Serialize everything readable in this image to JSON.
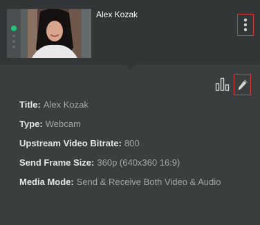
{
  "participant": {
    "name": "Alex Kozak",
    "status_color": "#22c77a"
  },
  "icons": {
    "menu": "more-vertical-icon",
    "stats": "bar-chart-icon",
    "edit": "pencil-icon"
  },
  "details": [
    {
      "label": "Title:",
      "value": "Alex Kozak"
    },
    {
      "label": "Type:",
      "value": "Webcam"
    },
    {
      "label": "Upstream Video Bitrate:",
      "value": "800"
    },
    {
      "label": "Send Frame Size:",
      "value": "360p (640x360 16:9)"
    },
    {
      "label": "Media Mode:",
      "value": "Send & Receive Both Video & Audio"
    }
  ]
}
